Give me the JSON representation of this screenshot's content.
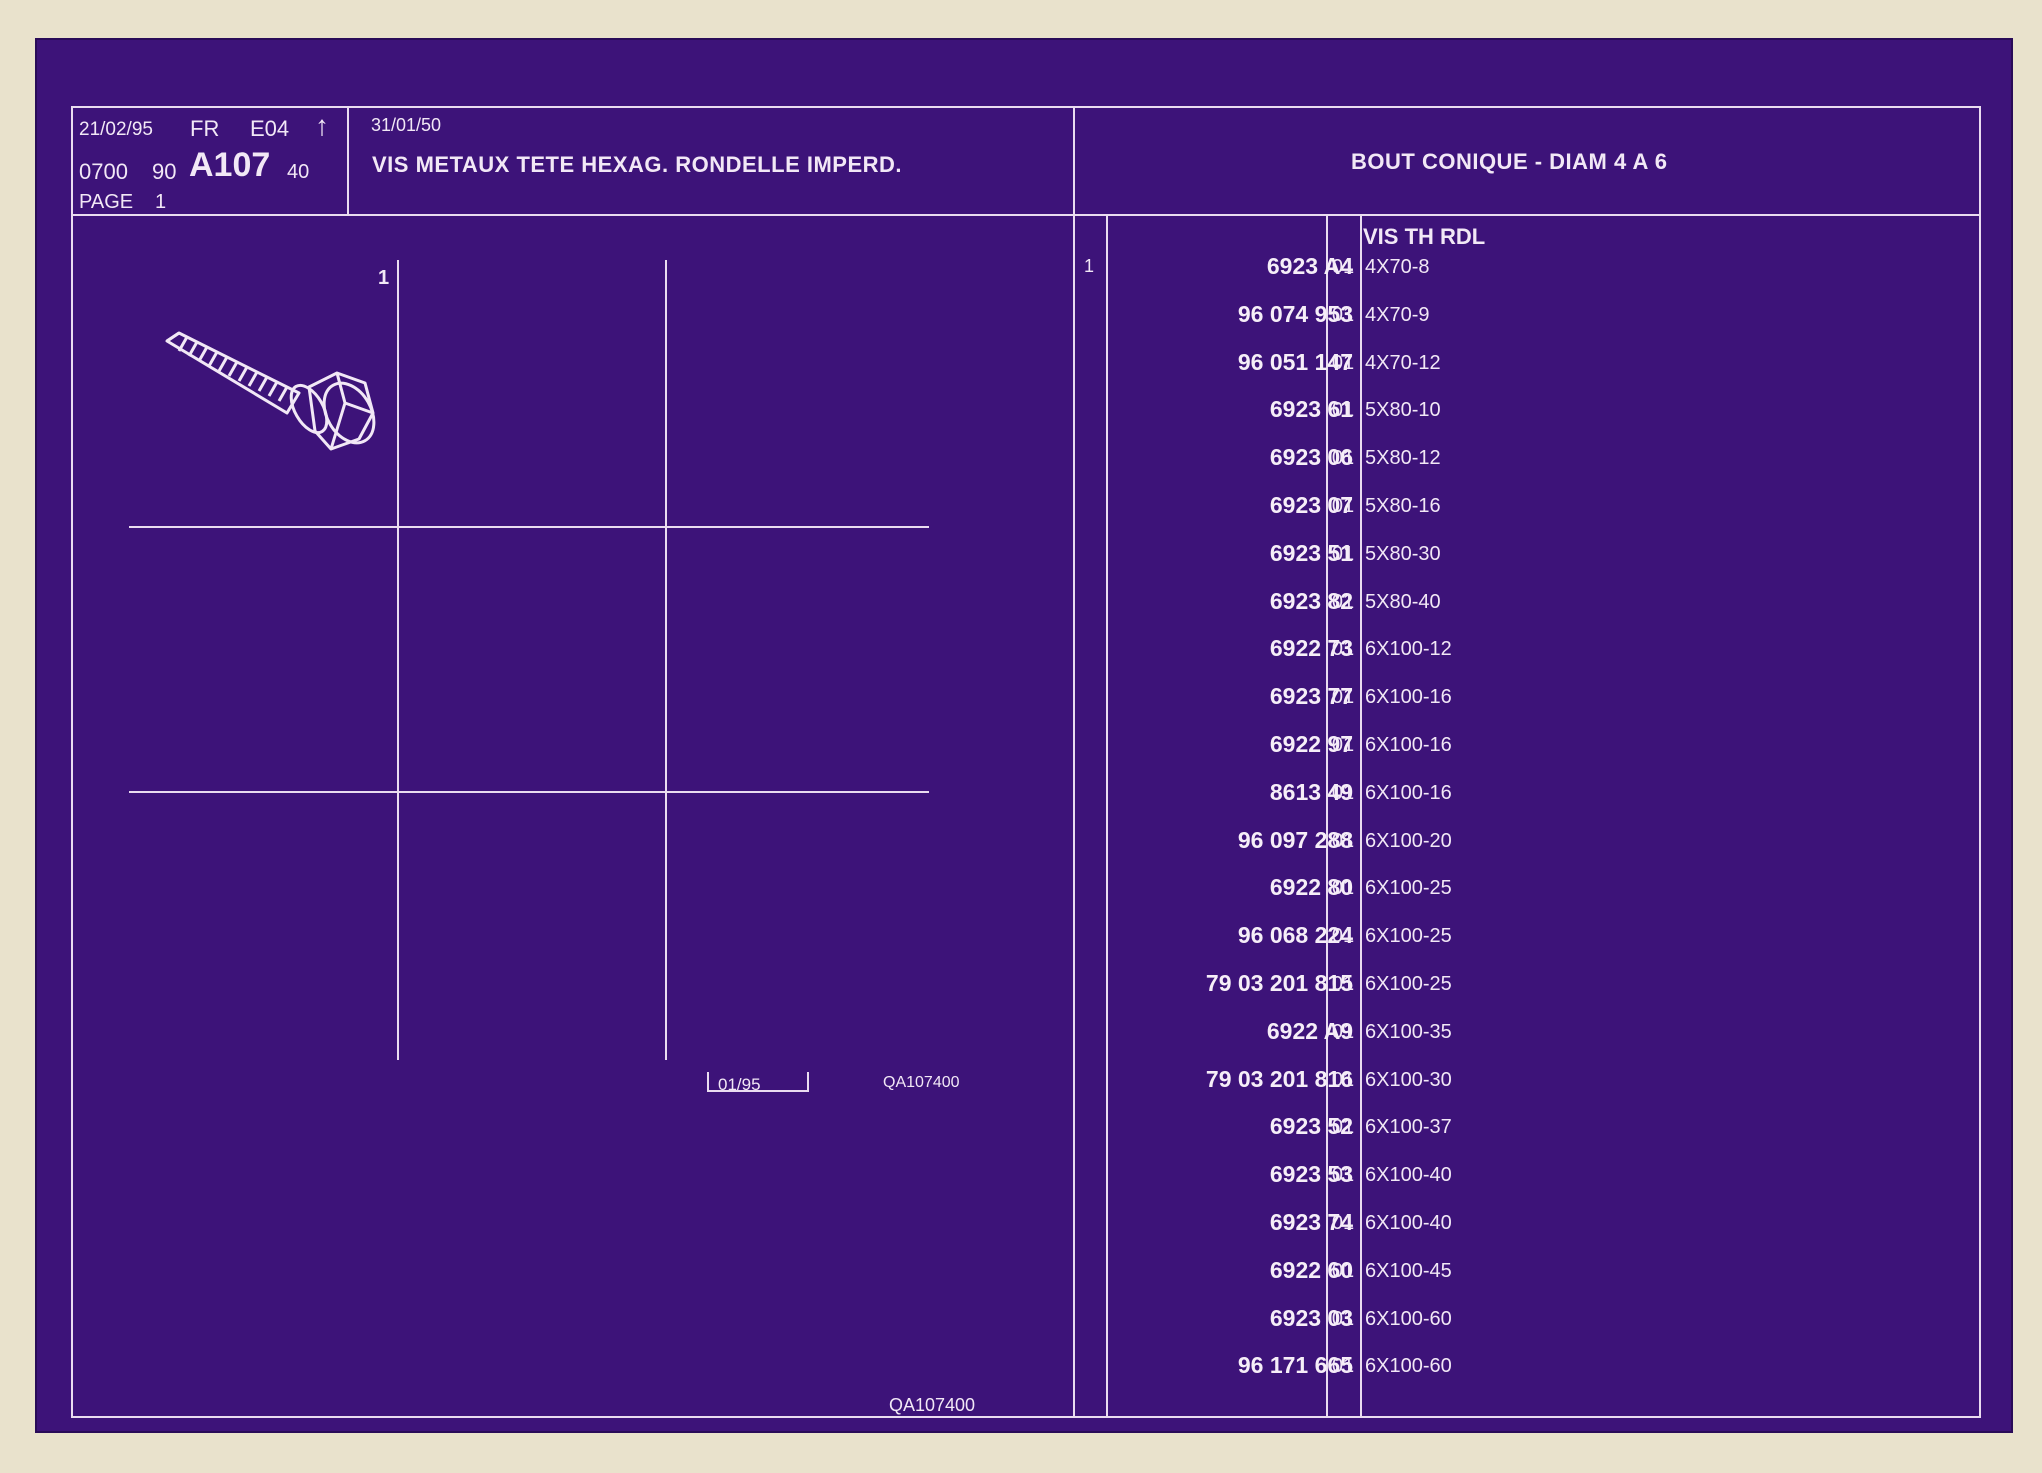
{
  "header": {
    "date": "21/02/95",
    "lang": "FR",
    "edition": "E04",
    "arrow": "↑",
    "group_code": "0700",
    "sub_code": "90",
    "plate_code": "A107",
    "plate_suffix": "40",
    "page_label": "PAGE",
    "page_number": "1",
    "start_date": "31/01/50",
    "title": "VIS METAUX TETE HEXAG. RONDELLE IMPERD.",
    "subtitle": "BOUT CONIQUE - DIAM 4 A 6"
  },
  "illustration": {
    "item_ref": "1",
    "stamp_date": "01/95",
    "drawing_code": "QA107400",
    "footer_code": "QA107400",
    "icon": "screw-icon"
  },
  "parts": {
    "column_header": "VIS TH RDL",
    "rows": [
      {
        "item": "1",
        "part": "6923 A4",
        "variant": "01",
        "desc": "4X70-8"
      },
      {
        "item": "",
        "part": "96 074 953",
        "variant": "01",
        "desc": "4X70-9"
      },
      {
        "item": "",
        "part": "96 051 147",
        "variant": "01",
        "desc": "4X70-12"
      },
      {
        "item": "",
        "part": "6923 61",
        "variant": "01",
        "desc": "5X80-10"
      },
      {
        "item": "",
        "part": "6923 06",
        "variant": "01",
        "desc": "5X80-12"
      },
      {
        "item": "",
        "part": "6923 07",
        "variant": "01",
        "desc": "5X80-16"
      },
      {
        "item": "",
        "part": "6923 51",
        "variant": "01",
        "desc": "5X80-30"
      },
      {
        "item": "",
        "part": "6923 82",
        "variant": "01",
        "desc": "5X80-40"
      },
      {
        "item": "",
        "part": "6922 73",
        "variant": "01",
        "desc": "6X100-12"
      },
      {
        "item": "",
        "part": "6923 77",
        "variant": "01",
        "desc": "6X100-16"
      },
      {
        "item": "",
        "part": "6922 97",
        "variant": "01",
        "desc": "6X100-16"
      },
      {
        "item": "",
        "part": "8613 49",
        "variant": "01",
        "desc": "6X100-16"
      },
      {
        "item": "",
        "part": "96 097 288",
        "variant": "01",
        "desc": "6X100-20"
      },
      {
        "item": "",
        "part": "6922 80",
        "variant": "01",
        "desc": "6X100-25"
      },
      {
        "item": "",
        "part": "96 068 224",
        "variant": "01",
        "desc": "6X100-25"
      },
      {
        "item": "",
        "part": "79 03 201 815",
        "variant": "01",
        "desc": "6X100-25"
      },
      {
        "item": "",
        "part": "6922 A9",
        "variant": "01",
        "desc": "6X100-35"
      },
      {
        "item": "",
        "part": "79 03 201 816",
        "variant": "01",
        "desc": "6X100-30"
      },
      {
        "item": "",
        "part": "6923 52",
        "variant": "01",
        "desc": "6X100-37"
      },
      {
        "item": "",
        "part": "6923 53",
        "variant": "01",
        "desc": "6X100-40"
      },
      {
        "item": "",
        "part": "6923 74",
        "variant": "01",
        "desc": "6X100-40"
      },
      {
        "item": "",
        "part": "6922 60",
        "variant": "01",
        "desc": "6X100-45"
      },
      {
        "item": "",
        "part": "6923 03",
        "variant": "01",
        "desc": "6X100-60"
      },
      {
        "item": "",
        "part": "96 171 665",
        "variant": "01",
        "desc": "6X100-60"
      }
    ]
  },
  "colors": {
    "sheet": "#3d1379",
    "ink": "#f2e8f6",
    "paper": "#e9e2cc"
  }
}
